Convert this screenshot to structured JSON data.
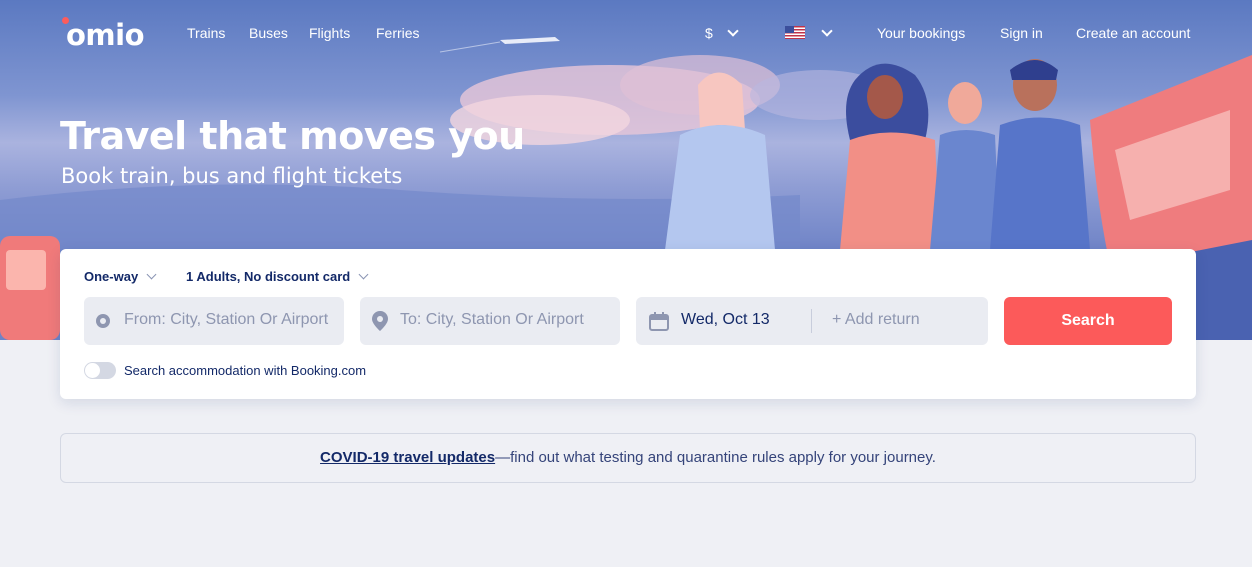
{
  "brand": {
    "logo": "omio"
  },
  "nav": {
    "links": [
      "Trains",
      "Buses",
      "Flights",
      "Ferries"
    ],
    "currency": "$",
    "your_bookings": "Your bookings",
    "sign_in": "Sign in",
    "create_account": "Create an account"
  },
  "hero": {
    "title": "Travel that moves you",
    "subtitle": "Book train, bus and flight tickets"
  },
  "search": {
    "trip_type": "One-way",
    "passengers": "1 Adults, No discount card",
    "from_placeholder": "From: City, Station Or Airport",
    "to_placeholder": "To: City, Station Or Airport",
    "date": "Wed, Oct 13",
    "add_return": "+ Add return",
    "button": "Search",
    "accommodation_toggle": "Search accommodation with Booking.com"
  },
  "notice": {
    "link": "COVID-19 travel updates",
    "text": "—find out what testing and quarantine rules apply for your journey."
  },
  "colors": {
    "accent": "#fc5a5a",
    "navy": "#132968",
    "hero_blue": "#6d82c6"
  }
}
